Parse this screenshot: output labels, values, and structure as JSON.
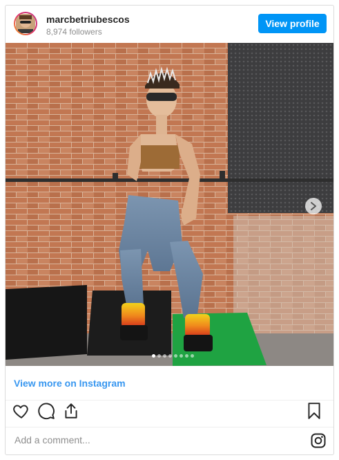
{
  "header": {
    "username": "marcbetriubescos",
    "followers": "8,974 followers",
    "view_profile_label": "View profile"
  },
  "photo": {
    "carousel_count": 8,
    "carousel_active_index": 0
  },
  "view_more_label": "View more on Instagram",
  "actions": {
    "like_icon": "heart-icon",
    "comment_icon": "comment-icon",
    "share_icon": "share-icon",
    "save_icon": "bookmark-icon"
  },
  "comment": {
    "placeholder": "Add a comment..."
  },
  "colors": {
    "accent": "#0095f6",
    "link": "#3897f0"
  }
}
